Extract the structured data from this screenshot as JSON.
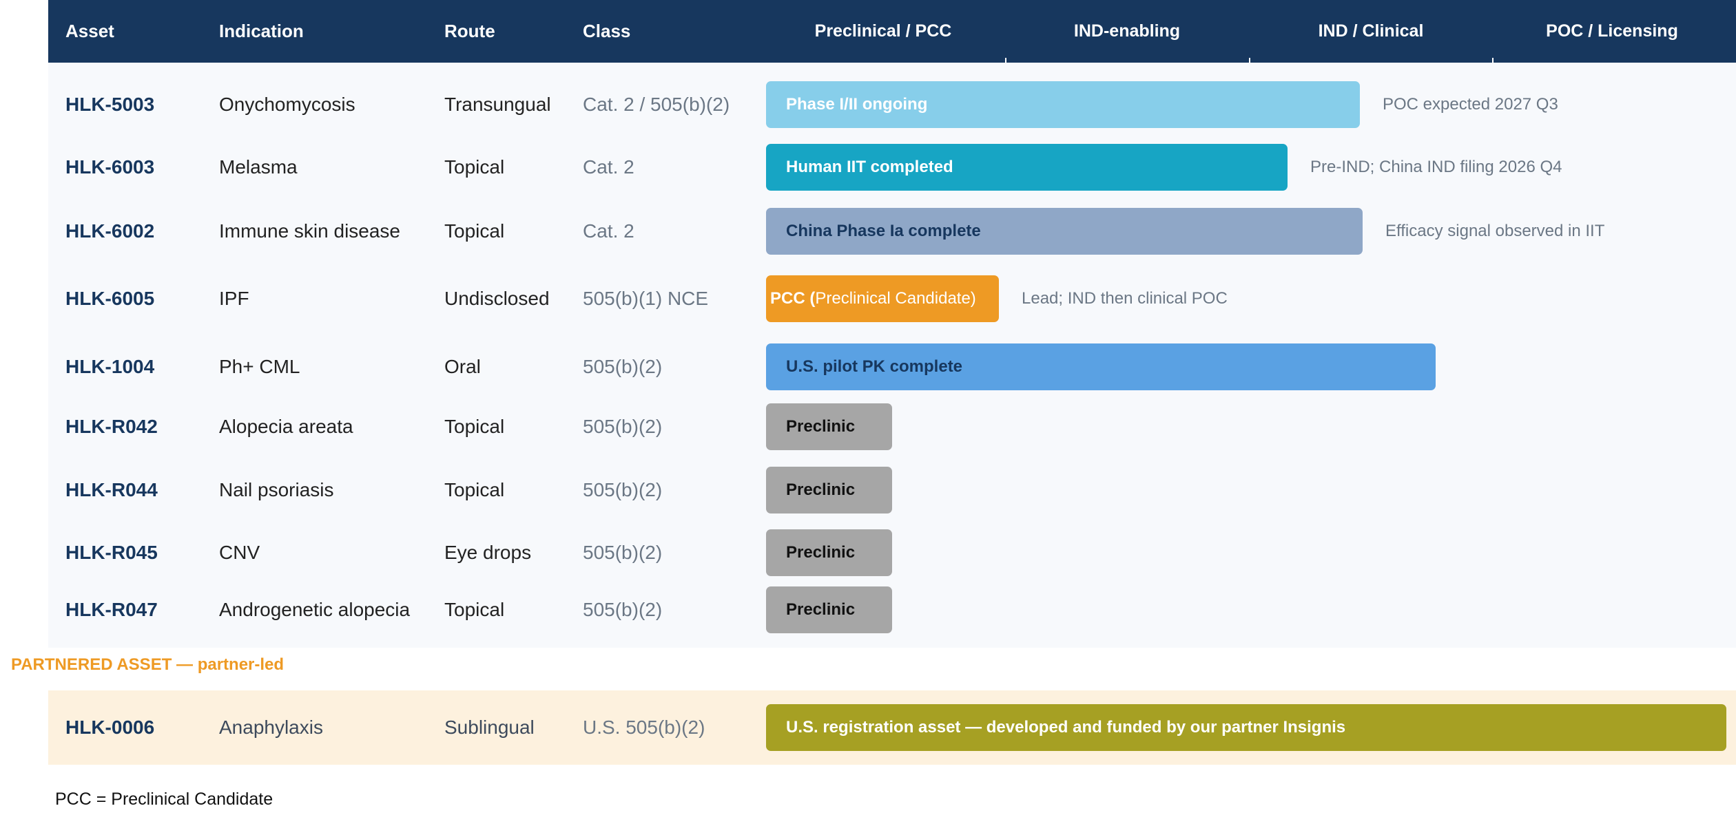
{
  "header": {
    "asset": "Asset",
    "indication": "Indication",
    "route": "Route",
    "class": "Class",
    "stages": [
      "Preclinical / PCC",
      "IND-enabling",
      "IND / Clinical",
      "POC / Licensing"
    ]
  },
  "colors": {
    "header_bg": "#17375e",
    "light_blue": "#87ceea",
    "teal": "#17a5c4",
    "slate": "#8fa7c7",
    "orange": "#ee9a24",
    "blue": "#5aa1e3",
    "gray": "#a6a6a6",
    "olive": "#a6a023",
    "partner_bg": "#fdf1de"
  },
  "chart_data": {
    "type": "bar",
    "orientation": "horizontal",
    "stage_axis": [
      "Preclinical / PCC",
      "IND-enabling",
      "IND / Clinical",
      "POC / Licensing"
    ],
    "xlim": [
      0,
      4
    ],
    "grid": false,
    "legend": "none",
    "rows": [
      {
        "asset": "HLK-5003",
        "indication": "Onychomycosis",
        "route": "Transungual",
        "class": "Cat. 2 / 505(b)(2)",
        "bar_label": "Phase I/II ongoing",
        "bar_label_sub": "",
        "progress": 2.45,
        "note": "POC expected 2027 Q3",
        "color": "#87ceea",
        "text_style": "light"
      },
      {
        "asset": "HLK-6003",
        "indication": "Melasma",
        "route": "Topical",
        "class": "Cat. 2",
        "bar_label": "Human IIT completed",
        "bar_label_sub": "",
        "progress": 2.15,
        "note": "Pre-IND; China IND filing 2026 Q4",
        "color": "#17a5c4",
        "text_style": "light"
      },
      {
        "asset": "HLK-6002",
        "indication": "Immune skin disease",
        "route": "Topical",
        "class": "Cat. 2",
        "bar_label": "China Phase Ia complete",
        "bar_label_sub": "",
        "progress": 2.46,
        "note": "Efficacy signal observed in IIT",
        "color": "#8fa7c7",
        "text_style": "dark"
      },
      {
        "asset": "HLK-6005",
        "indication": "IPF",
        "route": "Undisclosed",
        "class": "505(b)(1) NCE",
        "bar_label": "PCC (",
        "bar_label_sub": "Preclinical Candidate)",
        "progress": 0.96,
        "note": "Lead; IND then clinical POC",
        "color": "#ee9a24",
        "text_style": "light"
      },
      {
        "asset": "HLK-1004",
        "indication": "Ph+ CML",
        "route": "Oral",
        "class": "505(b)(2)",
        "bar_label": "U.S. pilot PK complete",
        "bar_label_sub": "",
        "progress": 2.76,
        "note": "",
        "color": "#5aa1e3",
        "text_style": "dark"
      },
      {
        "asset": "HLK-R042",
        "indication": "Alopecia areata",
        "route": "Topical",
        "class": "505(b)(2)",
        "bar_label": "Preclinic",
        "bar_label_sub": "",
        "progress": 0.52,
        "note": "",
        "color": "#a6a6a6",
        "text_style": "black"
      },
      {
        "asset": "HLK-R044",
        "indication": "Nail psoriasis",
        "route": "Topical",
        "class": "505(b)(2)",
        "bar_label": "Preclinic",
        "bar_label_sub": "",
        "progress": 0.52,
        "note": "",
        "color": "#a6a6a6",
        "text_style": "black"
      },
      {
        "asset": "HLK-R045",
        "indication": "CNV",
        "route": "Eye drops",
        "class": "505(b)(2)",
        "bar_label": "Preclinic",
        "bar_label_sub": "",
        "progress": 0.52,
        "note": "",
        "color": "#a6a6a6",
        "text_style": "black"
      },
      {
        "asset": "HLK-R047",
        "indication": "Androgenetic alopecia",
        "route": "Topical",
        "class": "505(b)(2)",
        "bar_label": "Preclinic",
        "bar_label_sub": "",
        "progress": 0.52,
        "note": "",
        "color": "#a6a6a6",
        "text_style": "black"
      }
    ],
    "partnered_section_label": "PARTNERED ASSET — partner-led",
    "partnered": [
      {
        "asset": "HLK-0006",
        "indication": "Anaphylaxis",
        "route": "Sublingual",
        "class": "U.S. 505(b)(2)",
        "bar_label": "U.S. registration asset — developed and funded by our partner Insignis",
        "bar_label_sub": "",
        "progress": 3.96,
        "note": "",
        "color": "#a6a023",
        "text_style": "light"
      }
    ]
  },
  "footnote": "PCC = Preclinical Candidate"
}
